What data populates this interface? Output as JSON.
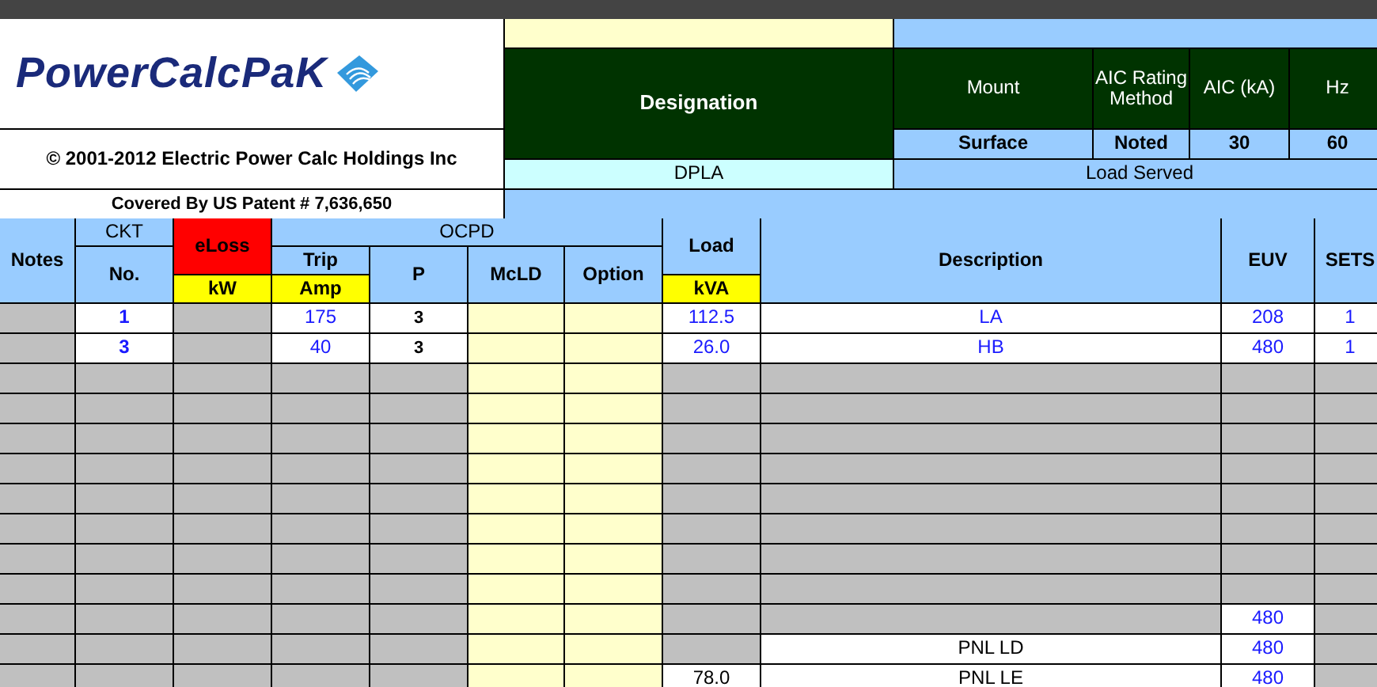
{
  "logo": {
    "text": "PowerCalcPaK"
  },
  "copyright": "© 2001-2012 Electric Power Calc Holdings Inc",
  "patent": "Covered By US Patent # 7,636,650",
  "panel": {
    "designation_label": "Designation",
    "designation": "DPLA",
    "mount_label": "Mount",
    "mount": "Surface",
    "aic_method_label": "AIC Rating Method",
    "aic_method": "Noted",
    "aic_label": "AIC (kA)",
    "aic": "30",
    "hz_label": "Hz",
    "hz": "60",
    "load_served_label": "Load  Served"
  },
  "table": {
    "headers": {
      "notes": "Notes",
      "ckt": "CKT",
      "ckt_sub": "No.",
      "eloss": "eLoss",
      "eloss_unit": "kW",
      "ocpd": "OCPD",
      "trip": "Trip",
      "trip_unit": "Amp",
      "p": "P",
      "mcld": "McLD",
      "option": "Option",
      "load": "Load",
      "load_unit": "kVA",
      "description": "Description",
      "euv": "EUV",
      "sets": "SETS"
    },
    "rows": [
      {
        "kind": "branch",
        "ckt": "1",
        "trip": "175",
        "p": "3",
        "kva": "112.5",
        "description": "LA",
        "euv": "208",
        "sets": "1"
      },
      {
        "kind": "branch",
        "ckt": "3",
        "trip": "40",
        "p": "3",
        "kva": "26.0",
        "description": "HB",
        "euv": "480",
        "sets": "1"
      },
      {
        "kind": "blank"
      },
      {
        "kind": "blank"
      },
      {
        "kind": "blank"
      },
      {
        "kind": "blank"
      },
      {
        "kind": "blank"
      },
      {
        "kind": "blank"
      },
      {
        "kind": "blank"
      },
      {
        "kind": "blank"
      },
      {
        "kind": "feeder",
        "euv": "480"
      },
      {
        "kind": "feeder",
        "description": "PNL LD",
        "euv": "480"
      },
      {
        "kind": "feeder",
        "kva": "78.0",
        "description": "PNL LE",
        "euv": "480"
      }
    ]
  }
}
